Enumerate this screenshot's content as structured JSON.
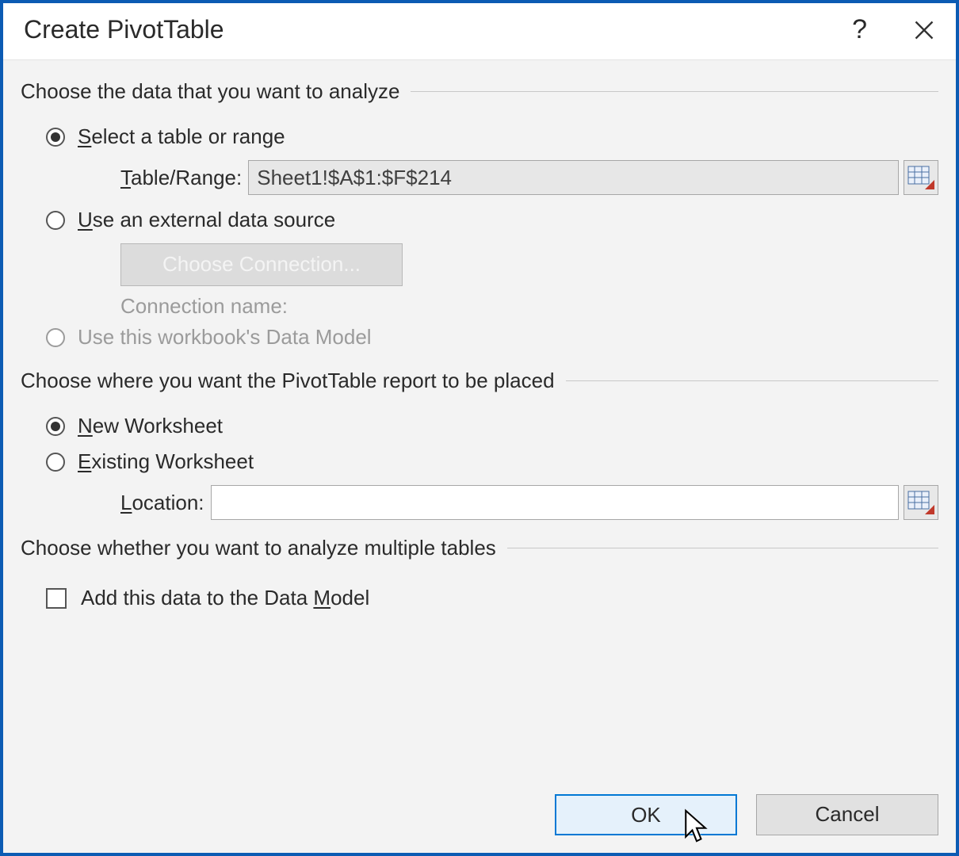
{
  "titlebar": {
    "title": "Create PivotTable",
    "help": "?"
  },
  "group1": {
    "heading": "Choose the data that you want to analyze",
    "opt_select": {
      "pre": "",
      "u": "S",
      "post": "elect a table or range"
    },
    "table_label": {
      "pre": "",
      "u": "T",
      "post": "able/Range:"
    },
    "table_value": "Sheet1!$A$1:$F$214",
    "opt_external": {
      "pre": "",
      "u": "U",
      "post": "se an external data source"
    },
    "choose_conn": "Choose Connection...",
    "conn_name_label": "Connection name:",
    "opt_datamodel": "Use this workbook's Data Model"
  },
  "group2": {
    "heading": "Choose where you want the PivotTable report to be placed",
    "opt_new": {
      "pre": "",
      "u": "N",
      "post": "ew Worksheet"
    },
    "opt_existing": {
      "pre": "",
      "u": "E",
      "post": "xisting Worksheet"
    },
    "loc_label": {
      "pre": "",
      "u": "L",
      "post": "ocation:"
    },
    "loc_value": ""
  },
  "group3": {
    "heading": "Choose whether you want to analyze multiple tables",
    "chk_label": {
      "pre": "Add this data to the Data ",
      "u": "M",
      "post": "odel"
    }
  },
  "footer": {
    "ok": "OK",
    "cancel": "Cancel"
  }
}
